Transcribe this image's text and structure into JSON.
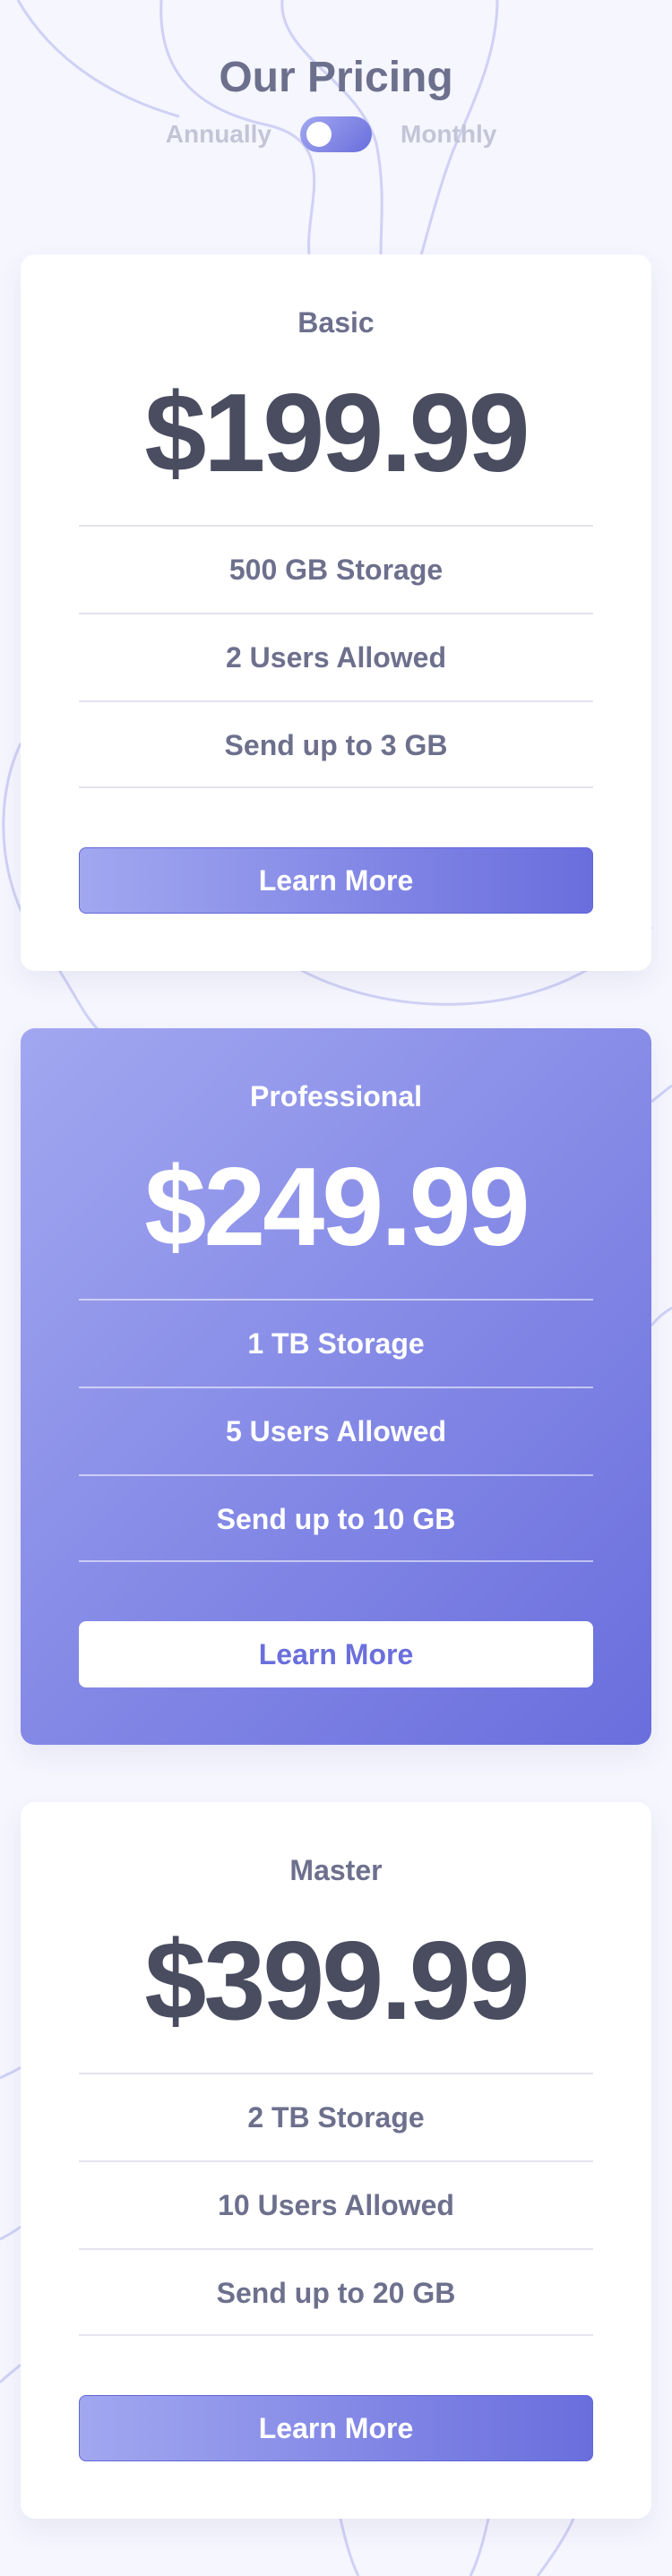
{
  "header": {
    "title": "Our Pricing",
    "toggle": {
      "left_label": "Annually",
      "right_label": "Monthly"
    }
  },
  "plans": [
    {
      "name": "Basic",
      "price": "$199.99",
      "features": [
        "500 GB Storage",
        "2 Users Allowed",
        "Send up to 3 GB"
      ],
      "button_label": "Learn More",
      "featured": false
    },
    {
      "name": "Professional",
      "price": "$249.99",
      "features": [
        "1 TB Storage",
        "5 Users Allowed",
        "Send up to 10 GB"
      ],
      "button_label": "Learn More",
      "featured": true
    },
    {
      "name": "Master",
      "price": "$399.99",
      "features": [
        "2 TB Storage",
        "10 Users Allowed",
        "Send up to 20 GB"
      ],
      "button_label": "Learn More",
      "featured": false
    }
  ],
  "colors": {
    "background": "#f5f6fe",
    "accent_start": "#a2a7f0",
    "accent_end": "#696edd",
    "heading_text": "#6d708d",
    "price_text": "#4a4d60",
    "toggle_label": "#c3c4d6"
  }
}
